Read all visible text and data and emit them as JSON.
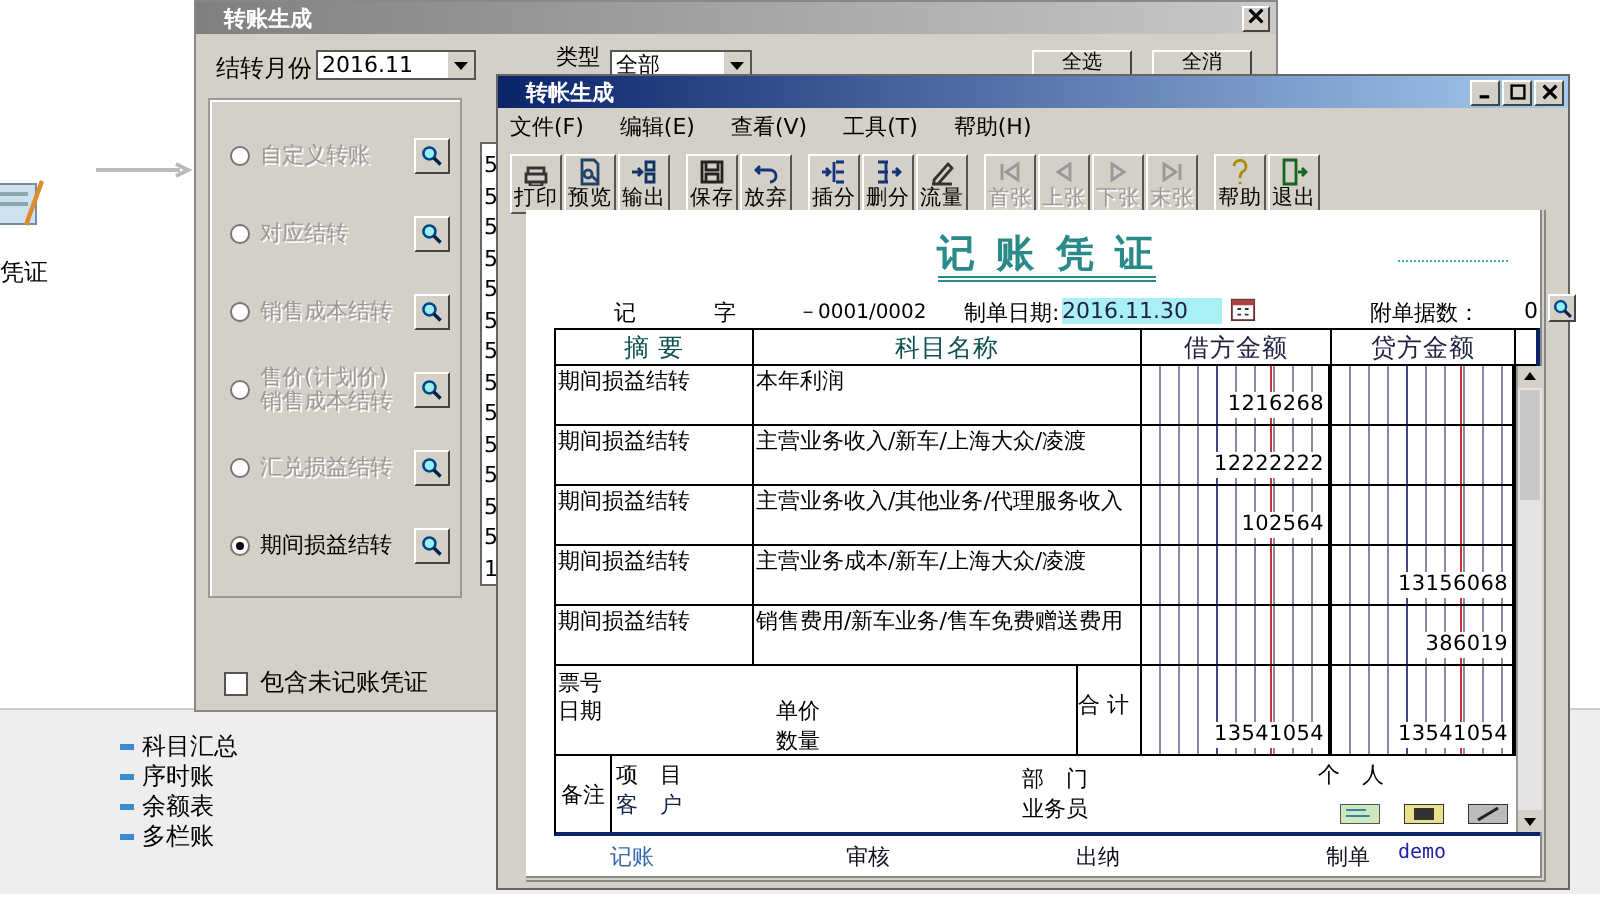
{
  "background": {
    "voucher_label": "凭证",
    "reports": [
      "科目汇总",
      "序时账",
      "余额表",
      "多栏账"
    ]
  },
  "back_dialog": {
    "title": "转账生成",
    "month_label": "结转月份",
    "month_value": "2016.11",
    "type_label": "类型",
    "type_value": "全部",
    "buttons": [
      "全选",
      "全消"
    ],
    "options": [
      {
        "label": "自定义转账",
        "selected": false,
        "disabled": true
      },
      {
        "label": "对应结转",
        "selected": false,
        "disabled": true
      },
      {
        "label": "销售成本结转",
        "selected": false,
        "disabled": true
      },
      {
        "label": "售价(计划价)销售成本结转",
        "selected": false,
        "disabled": true
      },
      {
        "label": "汇兑损益结转",
        "selected": false,
        "disabled": true
      },
      {
        "label": "期间损益结转",
        "selected": true,
        "disabled": false
      }
    ],
    "list_column": [
      "5",
      "5",
      "5",
      "5",
      "5",
      "5",
      "5",
      "5",
      "5",
      "5",
      "5",
      "5",
      "5",
      "1"
    ],
    "include_unposted": {
      "label": "包含未记账凭证",
      "checked": false
    }
  },
  "voucher_window": {
    "title": "转帐生成",
    "menu": [
      "文件(F)",
      "编辑(E)",
      "查看(V)",
      "工具(T)",
      "帮助(H)"
    ],
    "toolbar": [
      [
        {
          "label": "打印",
          "kind": "print",
          "disabled": false
        },
        {
          "label": "预览",
          "kind": "preview",
          "disabled": false
        },
        {
          "label": "输出",
          "kind": "export",
          "disabled": false
        }
      ],
      [
        {
          "label": "保存",
          "kind": "save",
          "disabled": false
        },
        {
          "label": "放弃",
          "kind": "undo",
          "disabled": false
        }
      ],
      [
        {
          "label": "插分",
          "kind": "insert",
          "disabled": false
        },
        {
          "label": "删分",
          "kind": "remove",
          "disabled": false
        },
        {
          "label": "流量",
          "kind": "flow",
          "disabled": false
        }
      ],
      [
        {
          "label": "首张",
          "kind": "first",
          "disabled": true
        },
        {
          "label": "上张",
          "kind": "prev",
          "disabled": true
        },
        {
          "label": "下张",
          "kind": "next",
          "disabled": true
        },
        {
          "label": "末张",
          "kind": "last",
          "disabled": true
        }
      ],
      [
        {
          "label": "帮助",
          "kind": "help",
          "disabled": false
        },
        {
          "label": "退出",
          "kind": "exit",
          "disabled": false
        }
      ]
    ],
    "voucher": {
      "title": "记 账 凭 证",
      "type_label": "记",
      "type_suffix": "字",
      "number": "－0001/0002",
      "date_label": "制单日期:",
      "date_value": "2016.11.30",
      "attachments_label": "附单据数：",
      "attachments_value": "0",
      "columns": [
        "摘 要",
        "科目名称",
        "借方金额",
        "贷方金额"
      ],
      "rows": [
        {
          "summary": "期间损益结转",
          "account": "本年利润",
          "debit": "1216268",
          "credit": ""
        },
        {
          "summary": "期间损益结转",
          "account": "主营业务收入/新车/上海大众/凌渡",
          "debit": "12222222",
          "credit": ""
        },
        {
          "summary": "期间损益结转",
          "account": "主营业务收入/其他业务/代理服务收入",
          "debit": "102564",
          "credit": ""
        },
        {
          "summary": "期间损益结转",
          "account": "主营业务成本/新车/上海大众/凌渡",
          "debit": "",
          "credit": "13156068"
        },
        {
          "summary": "期间损益结转",
          "account": "销售费用/新车业务/售车免费赠送费用",
          "debit": "",
          "credit": "386019"
        }
      ],
      "totals": {
        "ticket_label": "票号",
        "date_label": "日期",
        "price_label": "单价",
        "quantity_label": "数量",
        "total_label": "合 计",
        "debit": "13541054",
        "credit": "13541054"
      },
      "notes": {
        "label": "备注",
        "project_label": "项　目",
        "customer_label": "客　户",
        "dept_label": "部　门",
        "salesperson_label": "业务员",
        "person_label": "个　人"
      },
      "signatures": [
        {
          "label": "记账"
        },
        {
          "label": "审核"
        },
        {
          "label": "出纳"
        },
        {
          "label": "制单",
          "value": "demo"
        }
      ]
    }
  }
}
